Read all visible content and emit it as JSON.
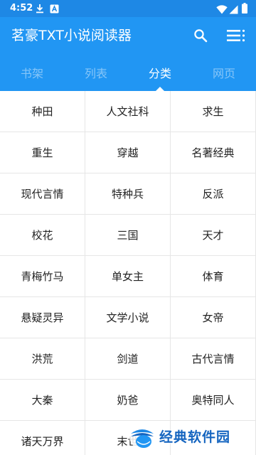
{
  "status_bar": {
    "time": "4:52",
    "left_icons": [
      "download-icon",
      "app-notification-icon"
    ],
    "right_icons": [
      "wifi-icon",
      "signal-icon",
      "battery-icon"
    ]
  },
  "app_bar": {
    "title": "茗豪TXT小说阅读器",
    "actions": [
      "search-icon",
      "menu-icon"
    ]
  },
  "tabs": [
    {
      "label": "书架",
      "active": false
    },
    {
      "label": "列表",
      "active": false
    },
    {
      "label": "分类",
      "active": true
    },
    {
      "label": "网页",
      "active": false
    }
  ],
  "categories": [
    "种田",
    "人文社科",
    "求生",
    "重生",
    "穿越",
    "名著经典",
    "现代言情",
    "特种兵",
    "反派",
    "校花",
    "三国",
    "天才",
    "青梅竹马",
    "单女主",
    "体育",
    "悬疑灵异",
    "文学小说",
    "女帝",
    "洪荒",
    "剑道",
    "古代言情",
    "大秦",
    "奶爸",
    "奥特同人",
    "诸天万界",
    "末世",
    ""
  ],
  "watermark": {
    "text": "经典软件园"
  },
  "colors": {
    "primary": "#2196f3",
    "status_bar": "#1e88e5",
    "divider": "#e6e6e6",
    "watermark": "#1565c0"
  }
}
